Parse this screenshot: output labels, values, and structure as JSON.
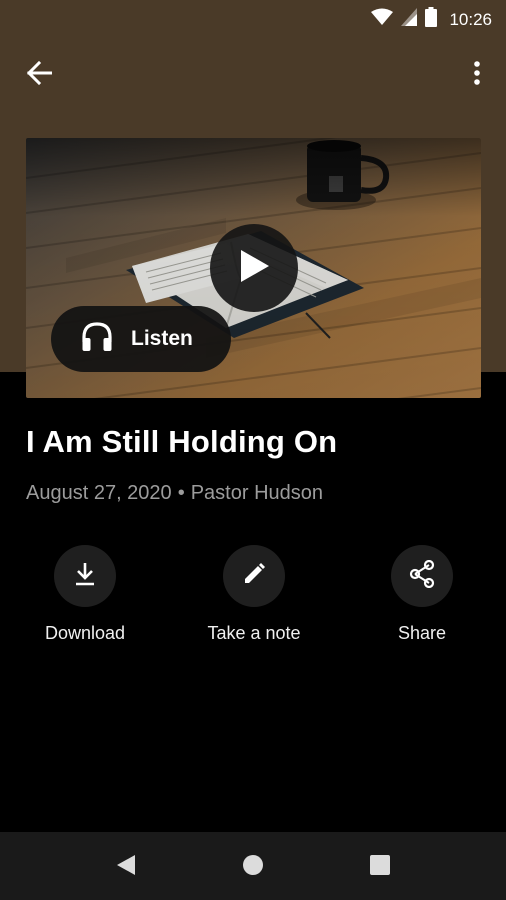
{
  "status_bar": {
    "time": "10:26"
  },
  "sermon": {
    "title": "I Am Still Holding On",
    "date": "August 27, 2020",
    "separator": "•",
    "speaker": "Pastor Hudson"
  },
  "hero": {
    "listen_label": "Listen"
  },
  "actions": [
    {
      "label": "Download"
    },
    {
      "label": "Take a note"
    },
    {
      "label": "Share"
    }
  ],
  "colors": {
    "header_background": "#4a3a28",
    "page_background": "#000000",
    "action_circle": "#1f1f1f",
    "meta_text": "#9c9c9c",
    "nav_bar": "#1a1a1a"
  }
}
